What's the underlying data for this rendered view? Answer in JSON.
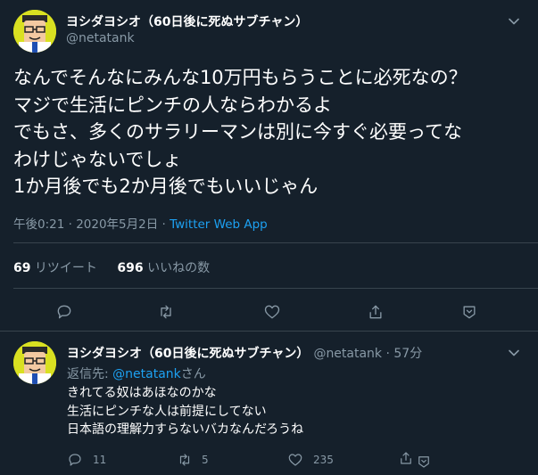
{
  "main_tweet": {
    "author_name": "ヨシダヨシオ（60日後に死ぬサブチャン）",
    "author_handle": "@netatank",
    "text": "なんでそんなにみんな10万円もらうことに必死なの？\nマジで生活にピンチの人ならわかるよ\nでもさ、多くのサラリーマンは別に今すぐ必要ってな\nわけじゃないでしょ\n1か月後でも2か月後でもいいじゃん",
    "timestamp": "午後0:21 · 2020年5月2日 · ",
    "source_app": "Twitter Web App",
    "retweet_count": "69",
    "retweet_label": " リツイート",
    "like_count": "696",
    "like_label": " いいねの数"
  },
  "reply_tweet": {
    "author_name": "ヨシダヨシオ（60日後に死ぬサブチャン）",
    "author_handle": "@netatank",
    "time": " · 57分",
    "reply_to_prefix": "返信先: ",
    "reply_to_mention": "@netatank",
    "reply_to_suffix": "さん",
    "text": "きれてる奴はあほなのかな\n生活にピンチな人は前提にしてない\n日本語の理解力すらないバカなんだろうね",
    "reply_count": "11",
    "retweet_count": "5",
    "like_count": "235"
  },
  "icons": {
    "caret": "chevron-down-icon",
    "reply": "reply-icon",
    "retweet": "retweet-icon",
    "like": "heart-icon",
    "share": "share-icon",
    "bookmark": "bookmark-icon"
  },
  "colors": {
    "background": "#15202b",
    "accent": "#1da1f2",
    "secondary_text": "#8899a6",
    "divider": "#38444d",
    "avatar_bg": "#d9e021"
  }
}
